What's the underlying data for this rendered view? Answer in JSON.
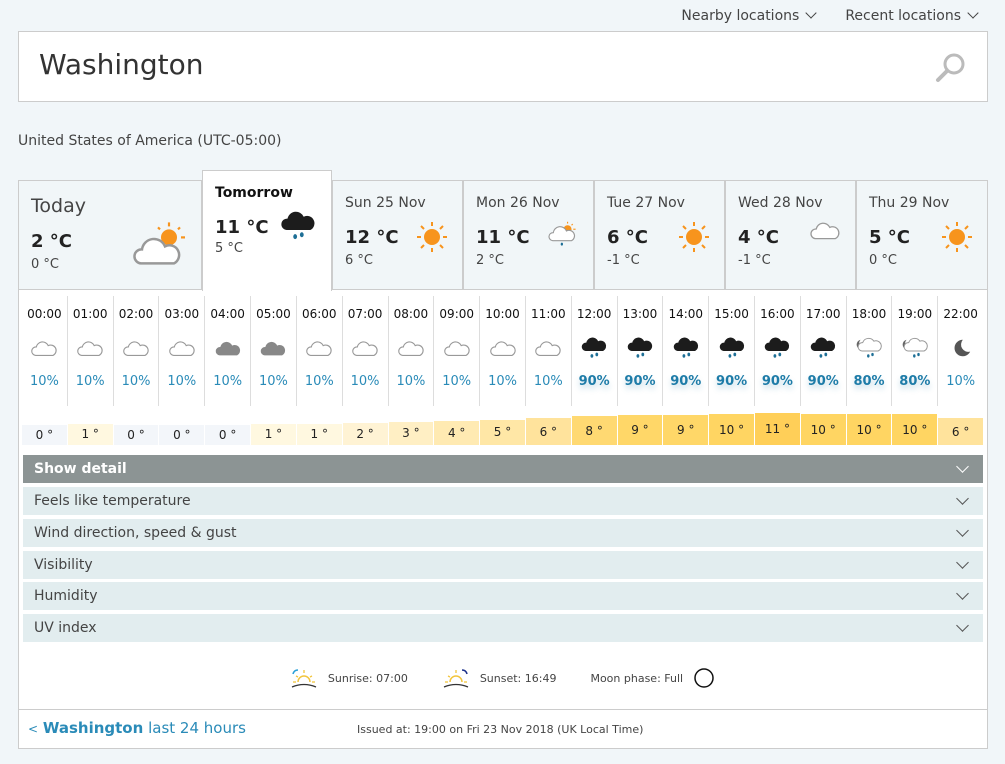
{
  "header": {
    "nearby": "Nearby locations",
    "recent": "Recent locations"
  },
  "search": {
    "value": "Washington"
  },
  "country": "United States of America (UTC-05:00)",
  "days": [
    {
      "name": "Today",
      "hi": "2 °C",
      "lo": "0 °C",
      "icon": "sun-cloud"
    },
    {
      "name": "Tomorrow",
      "hi": "11 °C",
      "lo": "5 °C",
      "icon": "heavy-rain"
    },
    {
      "name": "Sun 25 Nov",
      "hi": "12 °C",
      "lo": "6 °C",
      "icon": "sun"
    },
    {
      "name": "Mon 26 Nov",
      "hi": "11 °C",
      "lo": "2 °C",
      "icon": "sun-cloud-rain"
    },
    {
      "name": "Tue 27 Nov",
      "hi": "6 °C",
      "lo": "-1 °C",
      "icon": "sun"
    },
    {
      "name": "Wed 28 Nov",
      "hi": "4 °C",
      "lo": "-1 °C",
      "icon": "cloud"
    },
    {
      "name": "Thu 29 Nov",
      "hi": "5 °C",
      "lo": "0 °C",
      "icon": "sun"
    }
  ],
  "active_day": 1,
  "hours": [
    {
      "time": "00:00",
      "icon": "cloud",
      "precip": "10%",
      "temp": 0
    },
    {
      "time": "01:00",
      "icon": "cloud",
      "precip": "10%",
      "temp": 1
    },
    {
      "time": "02:00",
      "icon": "cloud",
      "precip": "10%",
      "temp": 0
    },
    {
      "time": "03:00",
      "icon": "cloud",
      "precip": "10%",
      "temp": 0
    },
    {
      "time": "04:00",
      "icon": "grey-cloud",
      "precip": "10%",
      "temp": 0
    },
    {
      "time": "05:00",
      "icon": "grey-cloud",
      "precip": "10%",
      "temp": 1
    },
    {
      "time": "06:00",
      "icon": "cloud",
      "precip": "10%",
      "temp": 1
    },
    {
      "time": "07:00",
      "icon": "cloud",
      "precip": "10%",
      "temp": 2
    },
    {
      "time": "08:00",
      "icon": "cloud",
      "precip": "10%",
      "temp": 3
    },
    {
      "time": "09:00",
      "icon": "cloud",
      "precip": "10%",
      "temp": 4
    },
    {
      "time": "10:00",
      "icon": "cloud",
      "precip": "10%",
      "temp": 5
    },
    {
      "time": "11:00",
      "icon": "cloud",
      "precip": "10%",
      "temp": 6
    },
    {
      "time": "12:00",
      "icon": "heavy-rain",
      "precip": "90%",
      "temp": 8
    },
    {
      "time": "13:00",
      "icon": "heavy-rain",
      "precip": "90%",
      "temp": 9
    },
    {
      "time": "14:00",
      "icon": "heavy-rain",
      "precip": "90%",
      "temp": 9
    },
    {
      "time": "15:00",
      "icon": "heavy-rain",
      "precip": "90%",
      "temp": 10
    },
    {
      "time": "16:00",
      "icon": "heavy-rain",
      "precip": "90%",
      "temp": 11
    },
    {
      "time": "17:00",
      "icon": "heavy-rain",
      "precip": "90%",
      "temp": 10
    },
    {
      "time": "18:00",
      "icon": "night-cloud-rain",
      "precip": "80%",
      "temp": 10
    },
    {
      "time": "19:00",
      "icon": "night-cloud-rain",
      "precip": "80%",
      "temp": 10
    },
    {
      "time": "22:00",
      "icon": "moon",
      "precip": "10%",
      "temp": 6
    }
  ],
  "detail": {
    "show": "Show detail",
    "rows": [
      "Feels like temperature",
      "Wind direction, speed & gust",
      "Visibility",
      "Humidity",
      "UV index"
    ]
  },
  "sun": {
    "sunrise": "Sunrise: 07:00",
    "sunset": "Sunset: 16:49",
    "moon": "Moon phase: Full"
  },
  "footer": {
    "back_prefix": "<",
    "back_place": "Washington",
    "back_suffix": "last 24 hours",
    "issued": "Issued at: 19:00 on Fri 23 Nov 2018  (UK Local Time)"
  },
  "colors": {
    "accent": "#2a8bb8",
    "sun": "#f7941d",
    "detail_bar": "#8c9494"
  }
}
